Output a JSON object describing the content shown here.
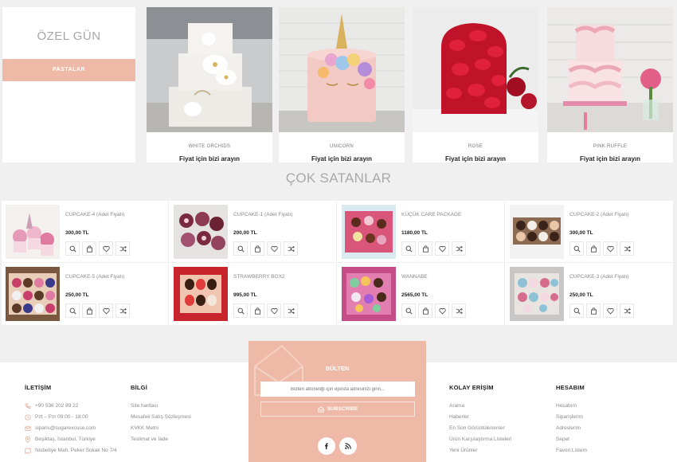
{
  "special": {
    "title": "ÖZEL GÜN",
    "category_button": "PASTALAR"
  },
  "featured": [
    {
      "name": "WHITE ORCHIDS",
      "price": "Fiyat için bizi arayın"
    },
    {
      "name": "UNICORN",
      "price": "Fiyat için bizi arayın"
    },
    {
      "name": "ROSE",
      "price": "Fiyat için bizi arayın"
    },
    {
      "name": "PINK RUFFLE",
      "price": "Fiyat için bizi arayın"
    }
  ],
  "bestsellers": {
    "title": "ÇOK SATANLAR",
    "products": [
      {
        "name": "CUPCAKE-4",
        "unit": "(Adet Fiyatı)",
        "price": "300,00 TL"
      },
      {
        "name": "CUPCAKE-1",
        "unit": "(Adet Fiyatı)",
        "price": "200,00 TL"
      },
      {
        "name": "KÜÇÜK CARE PACKAGE",
        "unit": "",
        "price": "1180,00 TL"
      },
      {
        "name": "CUPCAKE-2",
        "unit": "(Adet Fiyatı)",
        "price": "300,00 TL"
      },
      {
        "name": "CUPCAKE-5",
        "unit": "(Adet Fiyatı)",
        "price": "250,00 TL"
      },
      {
        "name": "STRAWBERRY BOX2",
        "unit": "",
        "price": "995,00 TL"
      },
      {
        "name": "WANNABE",
        "unit": "",
        "price": "2565,00 TL"
      },
      {
        "name": "CUPCAKE-3",
        "unit": "(Adet Fiyatı)",
        "price": "250,00 TL"
      }
    ]
  },
  "footer": {
    "contact": {
      "heading": "İLETİŞİM",
      "items": [
        {
          "icon": "phone-icon",
          "text": "+90 536 202 89 22"
        },
        {
          "icon": "clock-icon",
          "text": "Pzt – Pzr 09:00 - 18:00"
        },
        {
          "icon": "mail-icon",
          "text": "siparis@sugarexcuse.com"
        },
        {
          "icon": "location-icon",
          "text": "Beşiktaş, İstanbul, Türkiye"
        },
        {
          "icon": "map-icon",
          "text": "Nisbetiye Mah. Peker Sokak No 7/4"
        }
      ]
    },
    "info": {
      "heading": "BİLGİ",
      "items": [
        "Site haritası",
        "Mesafeli Satış Sözleşmesi",
        "KVKK Metni",
        "Teslimat ve İade"
      ]
    },
    "newsletter": {
      "heading": "BÜLTEN",
      "placeholder": "Bülten aboneliği için eposta adresinizi girin...",
      "button": "SUBSCRIBE"
    },
    "quick": {
      "heading": "KOLAY ERİŞİM",
      "items": [
        "Arama",
        "Haberler",
        "En Son Görüntülenenler",
        "Ürün Karşılaştırma Listeleri",
        "Yeni Ürünler"
      ]
    },
    "account": {
      "heading": "HESABIM",
      "items": [
        "Hesabım",
        "Siparişlerim",
        "Adreslerim",
        "Sepet",
        "Favori Listem"
      ]
    }
  }
}
